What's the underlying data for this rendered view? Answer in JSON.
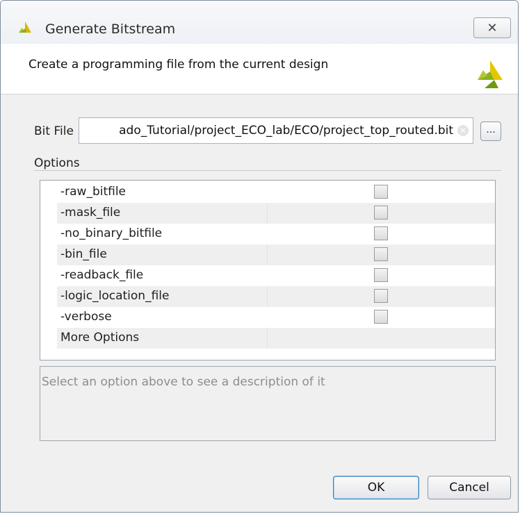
{
  "window": {
    "title": "Generate Bitstream",
    "close_symbol": "✕"
  },
  "header": {
    "description": "Create a programming file from the current design"
  },
  "bit_file": {
    "label": "Bit File",
    "value": "ado_Tutorial/project_ECO_lab/ECO/project_top_routed.bit",
    "browse_label": "..."
  },
  "options": {
    "label": "Options",
    "rows": [
      {
        "name": "-raw_bitfile",
        "checked": false
      },
      {
        "name": "-mask_file",
        "checked": false
      },
      {
        "name": "-no_binary_bitfile",
        "checked": false
      },
      {
        "name": "-bin_file",
        "checked": false
      },
      {
        "name": "-readback_file",
        "checked": false
      },
      {
        "name": "-logic_location_file",
        "checked": false
      },
      {
        "name": "-verbose",
        "checked": false
      },
      {
        "name": "More Options"
      }
    ]
  },
  "description_box": {
    "placeholder": "Select an option above to see a description of it"
  },
  "buttons": {
    "ok": "OK",
    "cancel": "Cancel"
  },
  "colors": {
    "brand_yellow": "#f4c20d",
    "brand_green": "#9bb820"
  }
}
